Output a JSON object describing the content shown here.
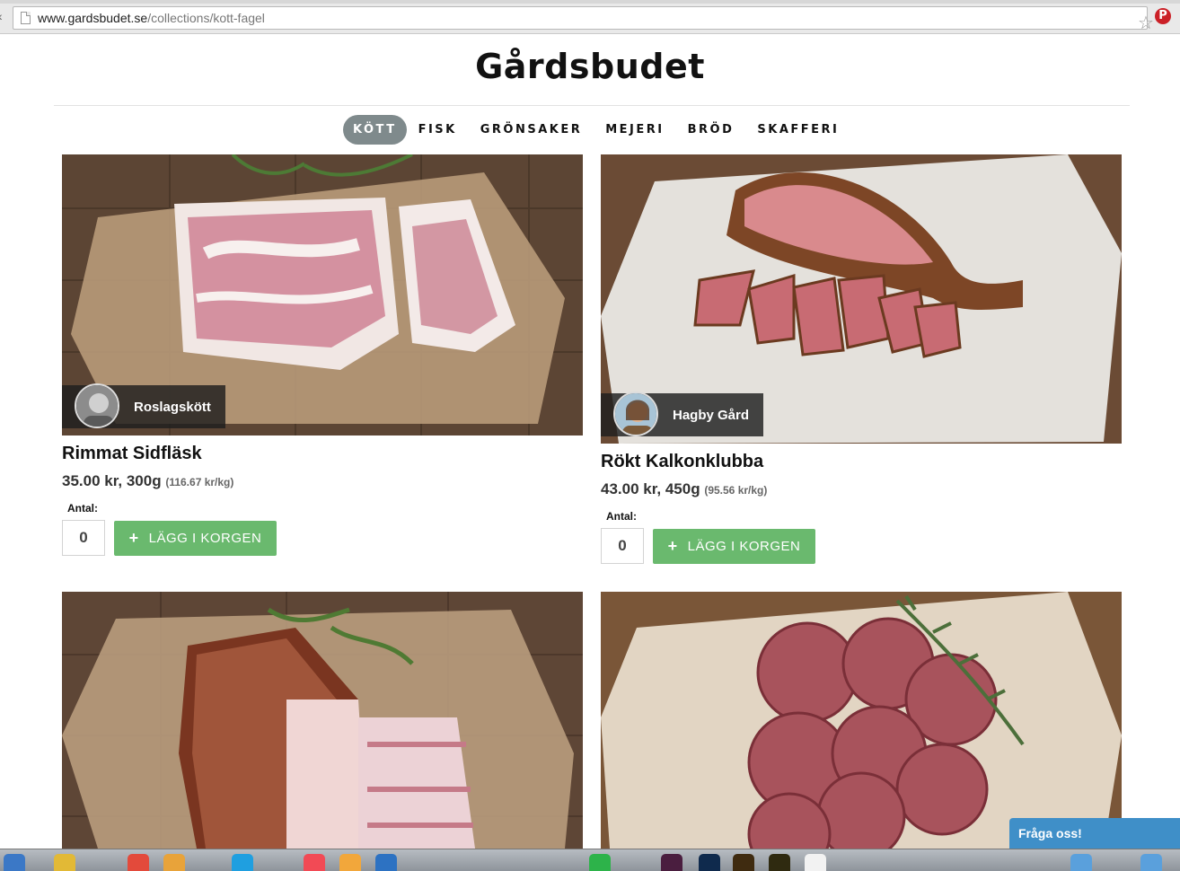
{
  "browser": {
    "url_host": "www.gardsbudet.se",
    "url_path": "/collections/kott-fagel"
  },
  "site": {
    "title": "Gårdsbudet",
    "nav": [
      {
        "label": "KÖTT",
        "active": true
      },
      {
        "label": "FISK",
        "active": false
      },
      {
        "label": "GRÖNSAKER",
        "active": false
      },
      {
        "label": "MEJERI",
        "active": false
      },
      {
        "label": "BRÖD",
        "active": false
      },
      {
        "label": "SKAFFERI",
        "active": false
      }
    ]
  },
  "products": [
    {
      "producer": "Roslagskött",
      "name": "Rimmat Sidfläsk",
      "price": "35.00 kr, 300g",
      "unit_price": "(116.67 kr/kg)",
      "qty_label": "Antal:",
      "qty": "0",
      "add_label": "LÄGG I KORGEN"
    },
    {
      "producer": "Hagby Gård",
      "name": "Rökt Kalkonklubba",
      "price": "43.00 kr, 450g",
      "unit_price": "(95.56 kr/kg)",
      "qty_label": "Antal:",
      "qty": "0",
      "add_label": "LÄGG I KORGEN"
    }
  ],
  "chat": {
    "label": "Fråga oss!"
  },
  "colors": {
    "nav_active_bg": "#7f8a8c",
    "add_button": "#6ab96e",
    "chat_widget": "#3f8fc8"
  },
  "icons": [
    "page-icon",
    "bookmark-star-icon",
    "pinterest-icon",
    "plus-icon"
  ]
}
